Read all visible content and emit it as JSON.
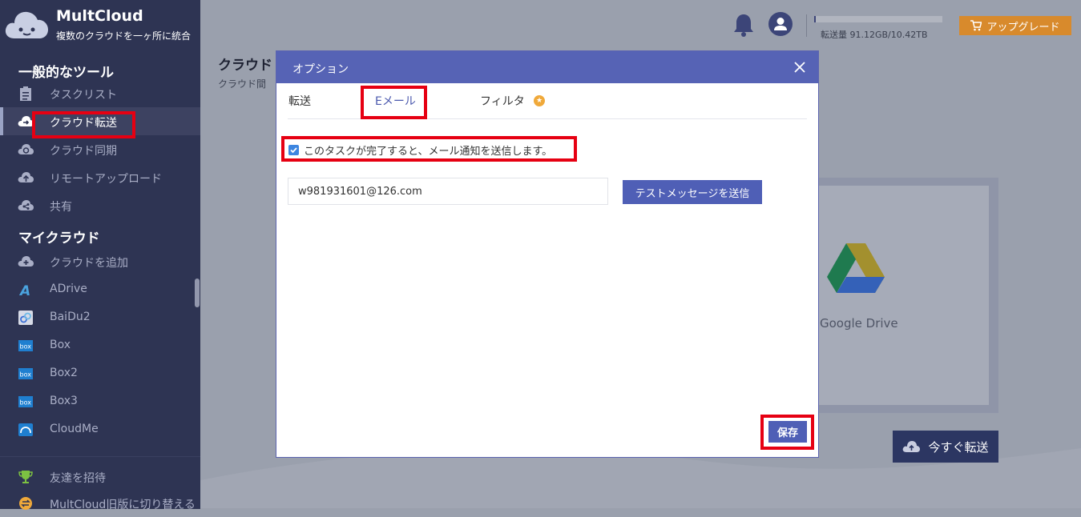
{
  "app": {
    "name": "MultCloud",
    "tagline": "複数のクラウドを一ヶ所に統合"
  },
  "sidebar": {
    "tools_heading": "一般的なツール",
    "tools": [
      {
        "label": "タスクリスト",
        "icon": "task-list-icon"
      },
      {
        "label": "クラウド転送",
        "icon": "cloud-transfer-icon",
        "active": true
      },
      {
        "label": "クラウド同期",
        "icon": "cloud-sync-icon"
      },
      {
        "label": "リモートアップロード",
        "icon": "remote-upload-icon"
      },
      {
        "label": "共有",
        "icon": "share-icon"
      }
    ],
    "clouds_heading": "マイクラウド",
    "clouds": [
      {
        "label": "クラウドを追加",
        "icon": "add-cloud-icon"
      },
      {
        "label": "ADrive",
        "icon": "adrive-icon"
      },
      {
        "label": "BaiDu2",
        "icon": "baidu-icon"
      },
      {
        "label": "Box",
        "icon": "box-icon"
      },
      {
        "label": "Box2",
        "icon": "box-icon"
      },
      {
        "label": "Box3",
        "icon": "box-icon"
      },
      {
        "label": "CloudMe",
        "icon": "cloudme-icon"
      }
    ],
    "bottom": [
      {
        "label": "友達を招待",
        "icon": "trophy-icon"
      },
      {
        "label": "MultCloud旧版に切り替える",
        "icon": "switch-icon"
      }
    ]
  },
  "header": {
    "usage_text": "転送量 91.12GB/10.42TB",
    "usage_fraction": 0.009,
    "upgrade_label": "アップグレード"
  },
  "page": {
    "title": "クラウド",
    "subtitle": "クラウド間"
  },
  "target": {
    "label": "Google Drive"
  },
  "transfer_now_label": "今すぐ転送",
  "modal": {
    "title": "オプション",
    "tabs": [
      {
        "label": "転送"
      },
      {
        "label": "Eメール",
        "active": true
      },
      {
        "label": "フィルタ"
      }
    ],
    "notify_checkbox_label": "このタスクが完了すると、メール通知を送信します。",
    "notify_checked": true,
    "email_value": "w981931601@126.com",
    "test_button_label": "テストメッセージを送信",
    "save_label": "保存"
  },
  "colors": {
    "sidebar_bg": "#2e3453",
    "modal_header": "#5663b5",
    "primary_button": "#4f5fb6",
    "upgrade_bg": "#d88a2c",
    "highlight": "#e60012"
  }
}
